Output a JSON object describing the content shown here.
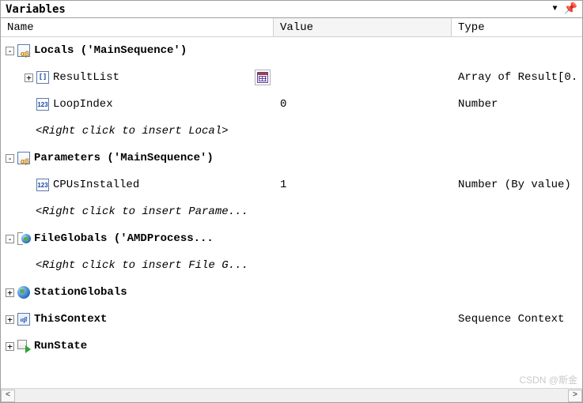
{
  "panel": {
    "title": "Variables"
  },
  "columns": {
    "name": "Name",
    "value": "Value",
    "type": "Type"
  },
  "tree": {
    "locals": {
      "label": "Locals ('MainSequence')",
      "resultList": {
        "label": "ResultList",
        "value": "",
        "type": "Array of Result[0."
      },
      "loopIndex": {
        "label": "LoopIndex",
        "value": "0",
        "type": "Number"
      },
      "hint": "<Right click to insert Local>"
    },
    "parameters": {
      "label": "Parameters ('MainSequence')",
      "cpusInstalled": {
        "label": "CPUsInstalled",
        "value": "1",
        "type": "Number (By value)"
      },
      "hint": "<Right click to insert Parame..."
    },
    "fileGlobals": {
      "label": "FileGlobals ('AMDProcess...",
      "hint": "<Right click to insert File G..."
    },
    "stationGlobals": {
      "label": "StationGlobals",
      "type": ""
    },
    "thisContext": {
      "label": "ThisContext",
      "type": "Sequence Context"
    },
    "runState": {
      "label": "RunState",
      "type": ""
    }
  },
  "watermark": "CSDN @斯金"
}
